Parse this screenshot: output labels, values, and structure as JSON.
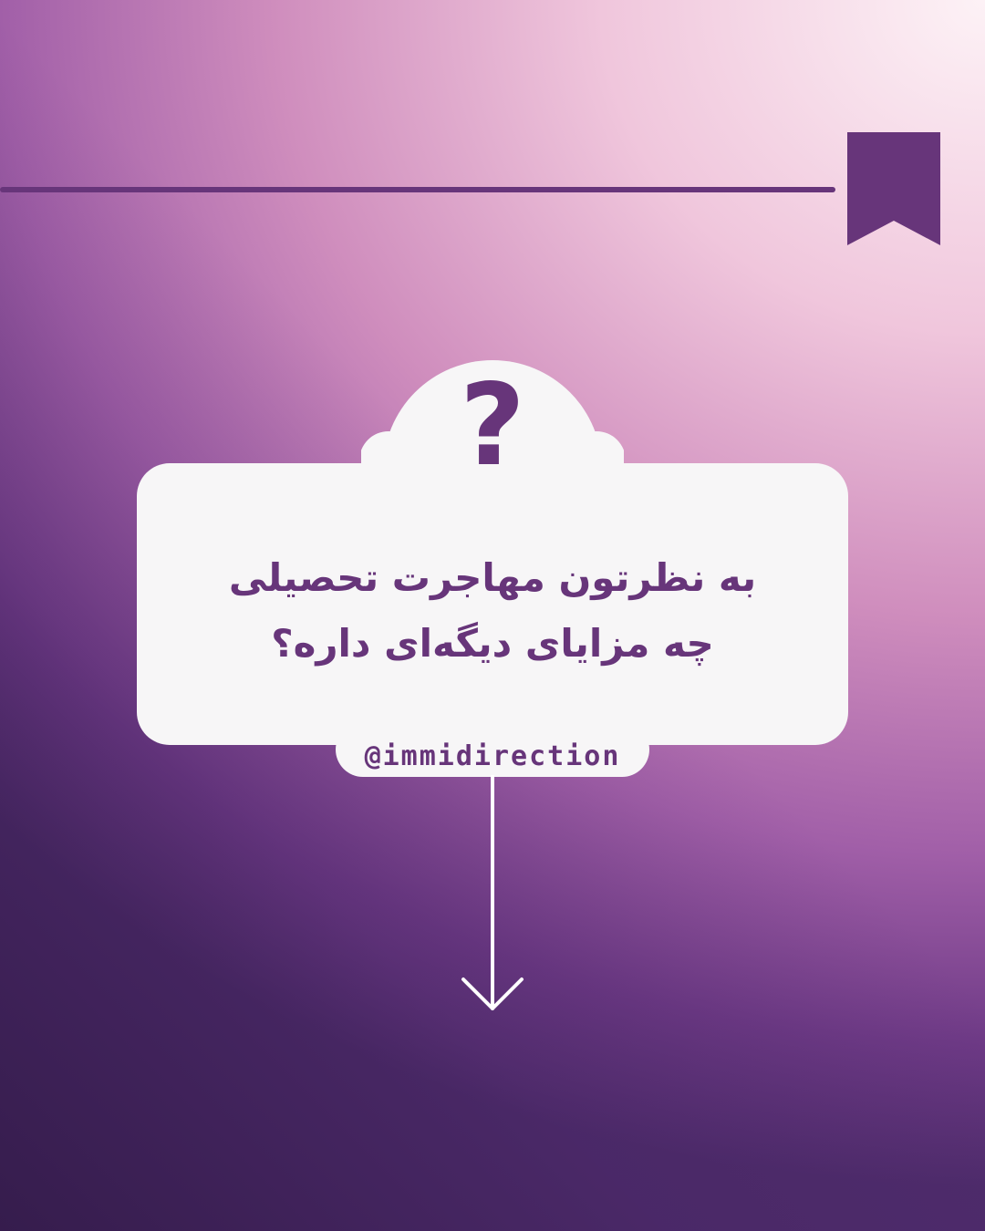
{
  "question": {
    "line1": "به نظرتون مهاجرت تحصیلی",
    "line2": "چه مزایای دیگه‌ای داره؟",
    "mark": "?"
  },
  "handle": "@immidirection",
  "colors": {
    "accent": "#67357a",
    "card": "#f7f6f7",
    "arrow": "#ffffff"
  },
  "icons": {
    "bookmark": "bookmark-icon",
    "arrow": "arrow-down-icon"
  }
}
